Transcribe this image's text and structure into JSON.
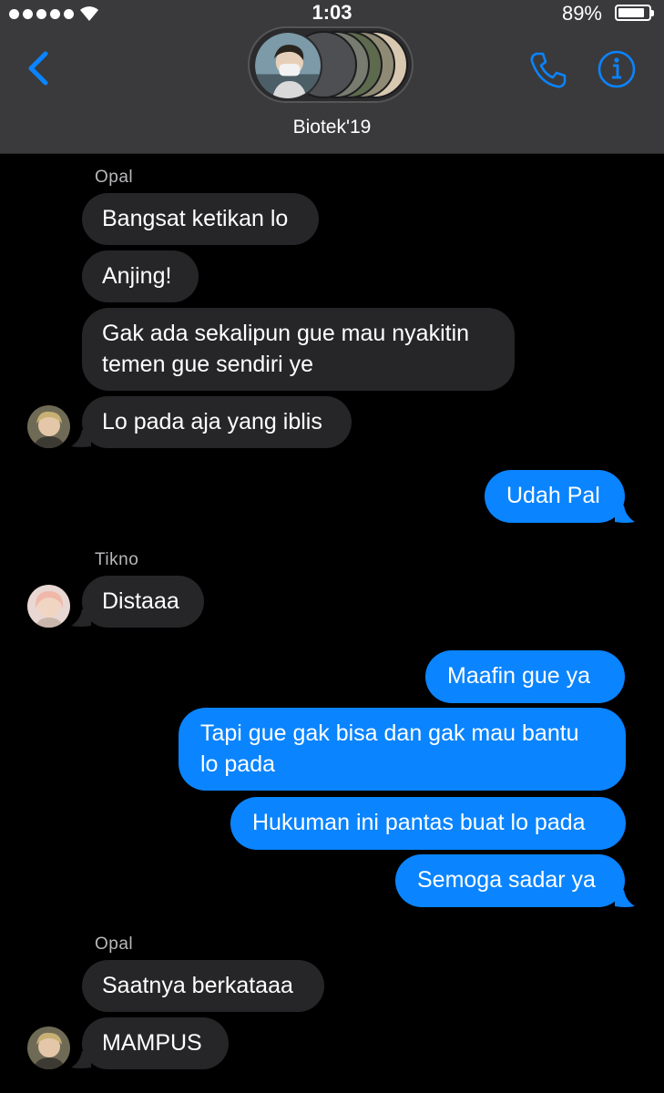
{
  "status_bar": {
    "time": "1:03",
    "battery_percent": "89%",
    "battery_level": 0.89,
    "signal_dots": 5
  },
  "nav": {
    "group_name": "Biotek'19",
    "back_icon": "chevron-left-icon",
    "call_icon": "phone-icon",
    "info_icon": "info-icon"
  },
  "colors": {
    "accent": "#0a84ff",
    "incoming_bubble": "#262628",
    "background": "#000000",
    "header": "#3a3a3c"
  },
  "messages": [
    {
      "sender_label": "Opal"
    },
    {
      "text": "Bangsat ketikan lo",
      "direction": "incoming"
    },
    {
      "text": "Anjing!",
      "direction": "incoming"
    },
    {
      "text_lines": [
        "Gak ada sekalipun gue mau nyakitin",
        "temen gue sendiri ye"
      ],
      "direction": "incoming"
    },
    {
      "text": "Lo pada aja yang iblis",
      "direction": "incoming"
    },
    {
      "text": "Udah Pal",
      "direction": "outgoing"
    },
    {
      "sender_label": "Tikno"
    },
    {
      "text": "Distaaa",
      "direction": "incoming"
    },
    {
      "text": "Maafin gue ya",
      "direction": "outgoing"
    },
    {
      "text_lines": [
        "Tapi gue gak bisa dan gak mau bantu",
        "lo pada"
      ],
      "direction": "outgoing"
    },
    {
      "text": "Hukuman ini pantas buat lo pada",
      "direction": "outgoing"
    },
    {
      "text": "Semoga sadar ya",
      "direction": "outgoing"
    },
    {
      "sender_label": "Opal"
    },
    {
      "text": "Saatnya berkataaa",
      "direction": "incoming"
    },
    {
      "text": "MAMPUS",
      "direction": "incoming"
    }
  ]
}
